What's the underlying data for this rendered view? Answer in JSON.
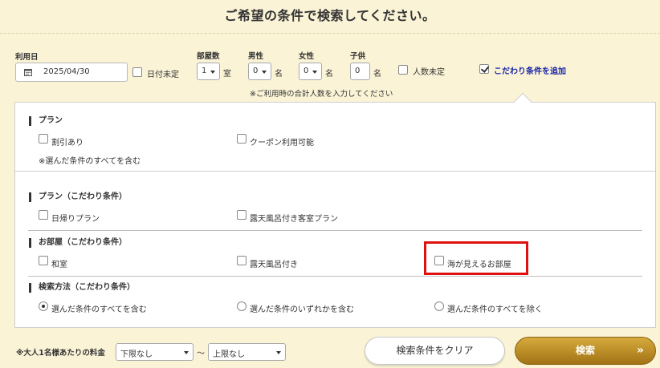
{
  "header": {
    "title": "ご希望の条件で検索してください。"
  },
  "form": {
    "date_label": "利用日",
    "date_value": "2025/04/30",
    "date_undecided": "日付未定",
    "rooms_label": "部屋数",
    "rooms_value": "1",
    "rooms_unit": "室",
    "male_label": "男性",
    "male_value": "0",
    "male_unit": "名",
    "female_label": "女性",
    "female_value": "0",
    "female_unit": "名",
    "child_label": "子供",
    "child_value": "0",
    "child_unit": "名",
    "people_undecided": "人数未定",
    "add_conditions": "こだわり条件を追加",
    "note": "※ご利用時の合計人数を入力してください"
  },
  "plan": {
    "title": "プラン",
    "options": [
      "割引あり",
      "クーポン利用可能"
    ],
    "note": "※選んだ条件のすべてを含む"
  },
  "plan_special": {
    "title": "プラン（こだわり条件）",
    "options": [
      "日帰りプラン",
      "露天風呂付き客室プラン"
    ]
  },
  "room_special": {
    "title": "お部屋（こだわり条件）",
    "options": [
      "和室",
      "露天風呂付き",
      "海が見えるお部屋"
    ]
  },
  "search_method": {
    "title": "検索方法（こだわり条件）",
    "options": [
      "選んだ条件のすべてを含む",
      "選んだ条件のいずれかを含む",
      "選んだ条件のすべてを除く"
    ]
  },
  "footer": {
    "price_label": "※大人1名様あたりの料金",
    "min_price": "下限なし",
    "tilde": "～",
    "max_price": "上限なし",
    "clear_button": "検索条件をクリア",
    "search_button": "検索",
    "search_chevron": "»"
  },
  "colors": {
    "accent_link": "#1a25a8",
    "highlight": "#e01010",
    "search_gold": "#b88a22"
  }
}
